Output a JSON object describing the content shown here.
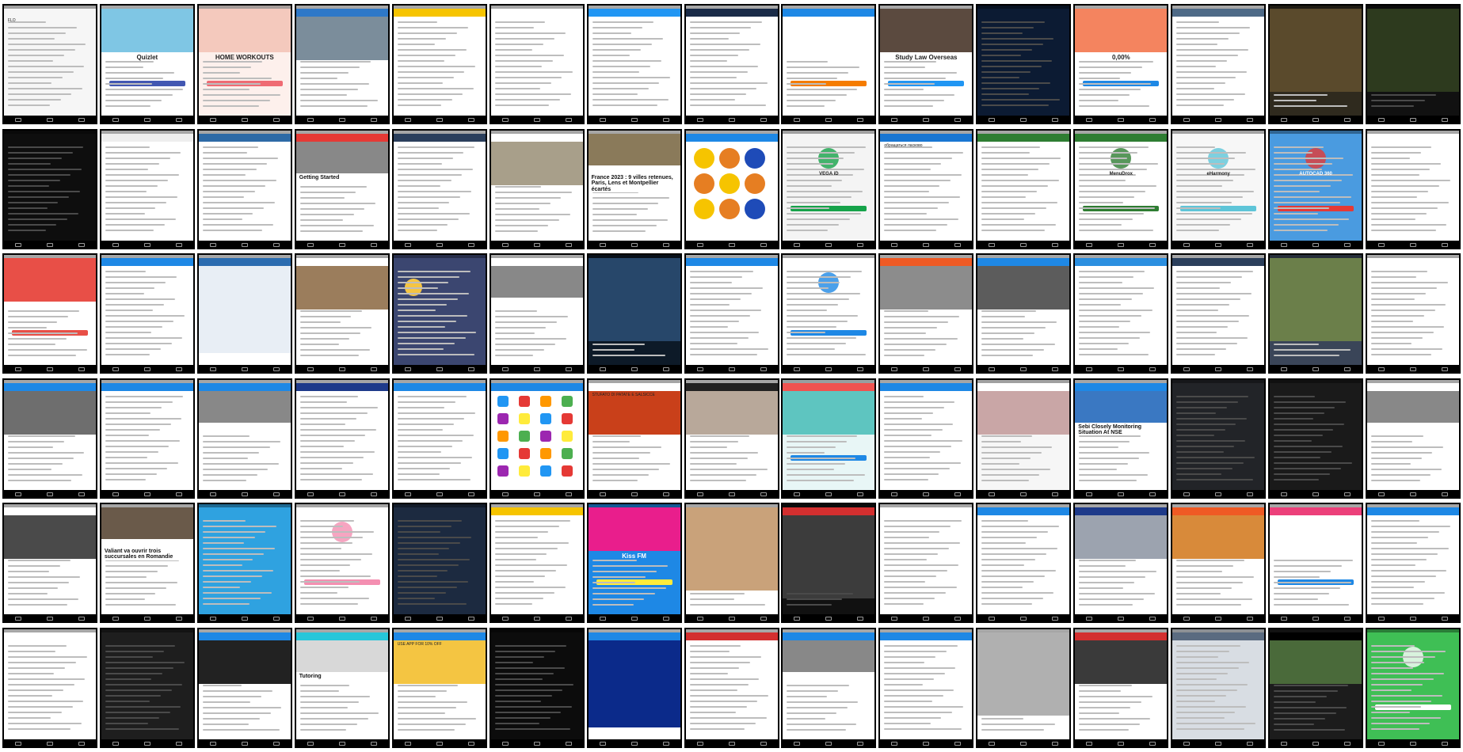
{
  "page": {
    "background": "#ffffff",
    "tile_border": "#000000"
  },
  "screens": [
    {
      "bg": "#f6f6f6",
      "style": "drawer",
      "title": "FLO"
    },
    {
      "bg": "#ffffff",
      "style": "hero",
      "title": "Quizlet",
      "hero_color": "#7fc6e4",
      "accent": "#4257b2"
    },
    {
      "bg": "#fdf0ec",
      "style": "hero",
      "title": "HOME WORKOUTS",
      "hero_color": "#f4c9bd",
      "accent": "#ef6b73"
    },
    {
      "bg": "#ffffff",
      "style": "photos",
      "title": "",
      "bar": "#2e78c8",
      "hero_color": "#7b8d9b"
    },
    {
      "bg": "#ffffff",
      "style": "list",
      "title": "",
      "bar": "#f6c400"
    },
    {
      "bg": "#ffffff",
      "style": "list",
      "title": "",
      "bar": "#ffffff",
      "accent": "#f39c12"
    },
    {
      "bg": "#ffffff",
      "style": "list",
      "title": "",
      "bar": "#2196f3",
      "accent": "#ff9800"
    },
    {
      "bg": "#ffffff",
      "style": "list",
      "title": "",
      "bar": "#1a2b48",
      "accent": "#2196f3"
    },
    {
      "bg": "#ffffff",
      "style": "hero",
      "title": "",
      "bar": "#1e88e5",
      "hero_color": "#ffffff",
      "accent": "#f57c00"
    },
    {
      "bg": "#ffffff",
      "style": "hero",
      "title": "Study Law Overseas",
      "hero_color": "#5b4a3f",
      "accent": "#2196f3"
    },
    {
      "bg": "#0c1b33",
      "style": "dark",
      "title": "",
      "accent": "#19d38a"
    },
    {
      "bg": "#ffffff",
      "style": "hero",
      "title": "0,00%",
      "hero_color": "#f4845f",
      "accent": "#1e88e5"
    },
    {
      "bg": "#ffffff",
      "style": "list",
      "title": "",
      "bar": "#4e6a87"
    },
    {
      "bg": "#2f2a1e",
      "style": "photo",
      "title": "",
      "hero_color": "#5a4a2c"
    },
    {
      "bg": "#111111",
      "style": "photo",
      "title": "",
      "hero_color": "#2d3a1e"
    },
    {
      "bg": "#0e0e0e",
      "style": "dark",
      "title": "",
      "accent": "#5a6d8a"
    },
    {
      "bg": "#ffffff",
      "style": "list",
      "title": "",
      "bar": "#eeeeee"
    },
    {
      "bg": "#ffffff",
      "style": "list",
      "title": "",
      "bar": "#2d6aa6",
      "accent": "#1565c0"
    },
    {
      "bg": "#ffffff",
      "style": "article",
      "title": "Getting Started",
      "bar": "#e53935"
    },
    {
      "bg": "#ffffff",
      "style": "drawer",
      "title": "",
      "bar": "#2b3f5c"
    },
    {
      "bg": "#ffffff",
      "style": "photos",
      "title": "",
      "bar": "#ffffff",
      "hero_color": "#a89f8a"
    },
    {
      "bg": "#ffffff",
      "style": "article",
      "title": "France 2023 : 9 villes retenues, Paris, Lens et Montpellier écartés",
      "hero_color": "#8a7a5a"
    },
    {
      "bg": "#ffffff",
      "style": "balls",
      "title": "",
      "bar": "#1e88e5"
    },
    {
      "bg": "#f4f4f4",
      "style": "login",
      "title": "VEGA iD",
      "accent": "#16a34a"
    },
    {
      "bg": "#ffffff",
      "style": "list",
      "title": "обращаться ласково",
      "bar": "#1976d2"
    },
    {
      "bg": "#ffffff",
      "style": "list",
      "title": "",
      "bar": "#2e7d32",
      "accent": "#43a047"
    },
    {
      "bg": "#ffffff",
      "style": "login",
      "title": "MenuDrox",
      "bar": "#2e7d32",
      "accent": "#2e7d32"
    },
    {
      "bg": "#f7f7f7",
      "style": "login",
      "title": "eHarmony",
      "accent": "#5ec5d8"
    },
    {
      "bg": "#4a9be0",
      "style": "login",
      "title": "AUTOCAD 360",
      "accent": "#e53935"
    },
    {
      "bg": "#ffffff",
      "style": "list",
      "title": "",
      "bar": "#ffffff",
      "accent": "#e53935"
    },
    {
      "bg": "#ffffff",
      "style": "hero",
      "title": "",
      "hero_color": "#e84f47",
      "accent": "#e84f47"
    },
    {
      "bg": "#ffffff",
      "style": "list",
      "title": "",
      "bar": "#1e88e5",
      "accent": "#e53935"
    },
    {
      "bg": "#ffffff",
      "style": "map",
      "title": "",
      "bar": "#2b6cb0",
      "accent": "#1a73e8"
    },
    {
      "bg": "#ffffff",
      "style": "photos",
      "title": "",
      "bar": "#ffffff",
      "hero_color": "#9b7d5c",
      "accent": "#d32f2f"
    },
    {
      "bg": "#3b4670",
      "style": "weather",
      "title": "",
      "accent": "#f5c542"
    },
    {
      "bg": "#ffffff",
      "style": "article",
      "title": "",
      "bar": "#ffffff"
    },
    {
      "bg": "#0d1a28",
      "style": "photo",
      "title": "",
      "hero_color": "#27476a"
    },
    {
      "bg": "#ffffff",
      "style": "list",
      "title": "",
      "bar": "#1e88e5"
    },
    {
      "bg": "#ffffff",
      "style": "login",
      "title": "",
      "accent": "#1e88e5"
    },
    {
      "bg": "#ffffff",
      "style": "photos",
      "title": "",
      "bar": "#ef5a24",
      "hero_color": "#8c8c8c"
    },
    {
      "bg": "#ffffff",
      "style": "photos",
      "title": "",
      "bar": "#1e88e5",
      "hero_color": "#5c5c5c"
    },
    {
      "bg": "#ffffff",
      "style": "list",
      "title": "",
      "bar": "#2b8fe0",
      "accent": "#1e88e5"
    },
    {
      "bg": "#ffffff",
      "style": "drawer",
      "title": "",
      "bar": "#2b3f5c",
      "accent": "#26a69a"
    },
    {
      "bg": "#3a4558",
      "style": "photo",
      "title": "",
      "hero_color": "#6b7f4a"
    },
    {
      "bg": "#ffffff",
      "style": "drawer",
      "title": "",
      "bar": "#ffffff",
      "accent": "#1e88e5"
    },
    {
      "bg": "#ffffff",
      "style": "photos",
      "title": "",
      "bar": "#1e88e5",
      "hero_color": "#6e6e6e"
    },
    {
      "bg": "#ffffff",
      "style": "list",
      "title": "",
      "bar": "#1e88e5",
      "accent": "#26c6da"
    },
    {
      "bg": "#ffffff",
      "style": "article",
      "title": "",
      "bar": "#1e88e5"
    },
    {
      "bg": "#ffffff",
      "style": "list",
      "title": "",
      "bar": "#1e3a8a",
      "accent": "#1e40af"
    },
    {
      "bg": "#ffffff",
      "style": "list",
      "title": "",
      "bar": "#1e88e5",
      "accent": "#8bc34a"
    },
    {
      "bg": "#ffffff",
      "style": "icons",
      "title": "",
      "bar": "#1e88e5"
    },
    {
      "bg": "#ffffff",
      "style": "photos",
      "title": "STUFATO DI PATATE E SALSICCE",
      "bar": "#ffffff",
      "hero_color": "#c9401a",
      "accent": "#ef5350"
    },
    {
      "bg": "#ffffff",
      "style": "photos",
      "title": "",
      "bar": "#222222",
      "hero_color": "#b8a89a"
    },
    {
      "bg": "#e8f6f6",
      "style": "hero",
      "title": "",
      "bar": "#ef5350",
      "hero_color": "#5ec5c0"
    },
    {
      "bg": "#ffffff",
      "style": "list",
      "title": "",
      "bar": "#1e88e5",
      "accent": "#1e88e5"
    },
    {
      "bg": "#f6f6f6",
      "style": "photos",
      "title": "",
      "bar": "#ffffff",
      "hero_color": "#c9a6a6"
    },
    {
      "bg": "#ffffff",
      "style": "article",
      "title": "Sebi Closely Monitoring Situation At NSE",
      "bar": "#1e88e5",
      "hero_color": "#3a78c2"
    },
    {
      "bg": "#222428",
      "style": "dark",
      "title": "",
      "accent": "#1e88e5"
    },
    {
      "bg": "#1a1a1a",
      "style": "dark",
      "title": "",
      "accent": "#3c4a3a"
    },
    {
      "bg": "#ffffff",
      "style": "article",
      "title": "",
      "bar": "#ffffff"
    },
    {
      "bg": "#ffffff",
      "style": "photos",
      "title": "",
      "bar": "#ffffff",
      "hero_color": "#4a4a4a"
    },
    {
      "bg": "#ffffff",
      "style": "article",
      "title": "Valiant va ouvrir trois succursales en Romandie",
      "hero_color": "#6a5a4a",
      "accent": "#d32f2f"
    },
    {
      "bg": "#2fa2e0",
      "style": "list",
      "title": "",
      "bar": "#2fa2e0"
    },
    {
      "bg": "#ffffff",
      "style": "login",
      "title": "",
      "bar": "#ffffff",
      "accent": "#f48fb1"
    },
    {
      "bg": "#1c2a40",
      "style": "dark",
      "title": "",
      "accent": "#e53935"
    },
    {
      "bg": "#ffffff",
      "style": "list",
      "title": "",
      "bar": "#f6c400",
      "accent": "#1e88e5"
    },
    {
      "bg": "#1e88e5",
      "style": "hero",
      "title": "Kiss FM",
      "hero_color": "#e91e8c",
      "accent": "#ffeb3b"
    },
    {
      "bg": "#ffffff",
      "style": "photo",
      "title": "",
      "hero_color": "#c9a27a"
    },
    {
      "bg": "#111111",
      "style": "photo",
      "title": "",
      "bar": "#d32f2f",
      "hero_color": "#3c3c3c"
    },
    {
      "bg": "#ffffff",
      "style": "list",
      "title": "",
      "bar": "#ffffff",
      "accent": "#1e88e5"
    },
    {
      "bg": "#ffffff",
      "style": "list",
      "title": "",
      "bar": "#1e88e5",
      "accent": "#1e88e5"
    },
    {
      "bg": "#ffffff",
      "style": "photos",
      "title": "",
      "bar": "#1e3a8a",
      "hero_color": "#9ca3af"
    },
    {
      "bg": "#ffffff",
      "style": "photos",
      "title": "",
      "bar": "#ef5a24",
      "hero_color": "#d88a3a"
    },
    {
      "bg": "#ffffff",
      "style": "hero",
      "title": "",
      "bar": "#ec407a",
      "hero_color": "#ffffff"
    },
    {
      "bg": "#ffffff",
      "style": "list",
      "title": "",
      "bar": "#1e88e5",
      "accent": "#4caf50"
    },
    {
      "bg": "#ffffff",
      "style": "list",
      "title": "",
      "bar": "#ffffff",
      "accent": "#4caf50"
    },
    {
      "bg": "#1e1e1e",
      "style": "dark",
      "title": "",
      "accent": "#4caf50"
    },
    {
      "bg": "#ffffff",
      "style": "photos",
      "title": "",
      "bar": "#1e88e5",
      "hero_color": "#222222"
    },
    {
      "bg": "#ffffff",
      "style": "article",
      "title": "Tutoring",
      "bar": "#26c6da",
      "hero_color": "#d8d8d8"
    },
    {
      "bg": "#ffffff",
      "style": "photos",
      "title": "USE APP FOR 10% OFF",
      "bar": "#1e88e5",
      "hero_color": "#f4c542"
    },
    {
      "bg": "#0c0c0c",
      "style": "dark",
      "title": "",
      "accent": "#ffffff"
    },
    {
      "bg": "#ffffff",
      "style": "map",
      "title": "",
      "bar": "#1e88e5",
      "hero_color": "#0b2a8a",
      "accent": "#2e7d32"
    },
    {
      "bg": "#ffffff",
      "style": "drawer",
      "title": "",
      "bar": "#d32f2f"
    },
    {
      "bg": "#ffffff",
      "style": "article",
      "title": "",
      "bar": "#1e88e5"
    },
    {
      "bg": "#ffffff",
      "style": "drawer",
      "title": "",
      "bar": "#1e88e5"
    },
    {
      "bg": "#ffffff",
      "style": "photo",
      "title": "",
      "hero_color": "#b0b0b0"
    },
    {
      "bg": "#ffffff",
      "style": "photos",
      "title": "",
      "bar": "#d32f2f",
      "hero_color": "#3a3a3a"
    },
    {
      "bg": "#d8dde3",
      "style": "list",
      "title": "",
      "bar": "#5a6b80"
    },
    {
      "bg": "#1c1c1c",
      "style": "photos",
      "title": "",
      "bar": "#000000",
      "hero_color": "#4a6a3a"
    },
    {
      "bg": "#3fbf55",
      "style": "login",
      "title": "",
      "bar": "#3fbf55",
      "accent": "#ffffff"
    }
  ]
}
